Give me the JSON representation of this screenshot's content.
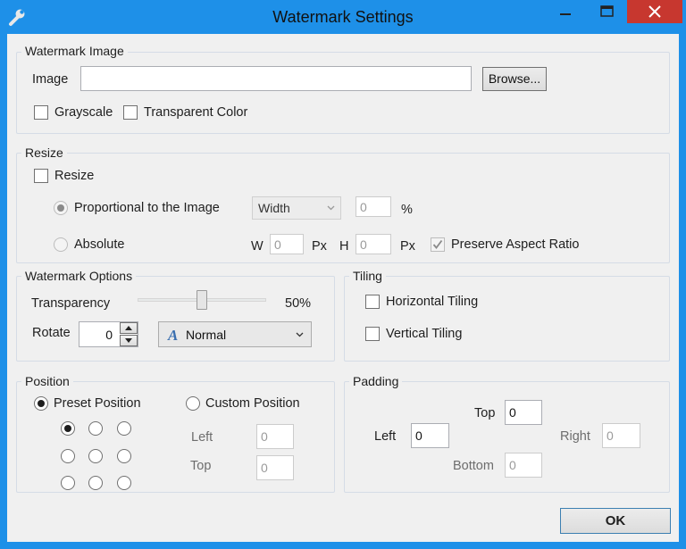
{
  "window": {
    "title": "Watermark Settings",
    "accent_color": "#1e90e8",
    "close_color": "#c7372f",
    "icons": {
      "app": "wrench-icon",
      "minimize": "minimize-icon",
      "maximize": "maximize-icon",
      "close": "close-icon"
    }
  },
  "watermark_image": {
    "group_label": "Watermark Image",
    "image_label": "Image",
    "image_value": "",
    "browse_label": "Browse...",
    "grayscale_label": "Grayscale",
    "grayscale_checked": false,
    "transparent_color_label": "Transparent Color",
    "transparent_color_checked": false
  },
  "resize": {
    "group_label": "Resize",
    "resize_label": "Resize",
    "resize_checked": false,
    "proportional_label": "Proportional to the Image",
    "proportional_selected": true,
    "dimension_value": "Width",
    "percent_value": "0",
    "percent_unit": "%",
    "absolute_label": "Absolute",
    "absolute_selected": false,
    "w_label": "W",
    "w_value": "0",
    "px_label": "Px",
    "h_label": "H",
    "h_value": "0",
    "preserve_label": "Preserve Aspect Ratio",
    "preserve_checked": true
  },
  "watermark_options": {
    "group_label": "Watermark Options",
    "transparency_label": "Transparency",
    "transparency_value": 50,
    "transparency_text": "50%",
    "rotate_label": "Rotate",
    "rotate_value": "0",
    "blend_mode": "Normal",
    "blend_icon": "font-a-icon"
  },
  "tiling": {
    "group_label": "Tiling",
    "horizontal_label": "Horizontal Tiling",
    "horizontal_checked": false,
    "vertical_label": "Vertical Tiling",
    "vertical_checked": false
  },
  "position": {
    "group_label": "Position",
    "preset_label": "Preset Position",
    "preset_selected": true,
    "custom_label": "Custom Position",
    "custom_selected": false,
    "selected_cell": 0,
    "left_label": "Left",
    "left_value": "0",
    "top_label": "Top",
    "top_value": "0"
  },
  "padding": {
    "group_label": "Padding",
    "top_label": "Top",
    "top_value": "0",
    "left_label": "Left",
    "left_value": "0",
    "right_label": "Right",
    "right_value": "0",
    "bottom_label": "Bottom",
    "bottom_value": "0"
  },
  "footer": {
    "ok_label": "OK"
  }
}
